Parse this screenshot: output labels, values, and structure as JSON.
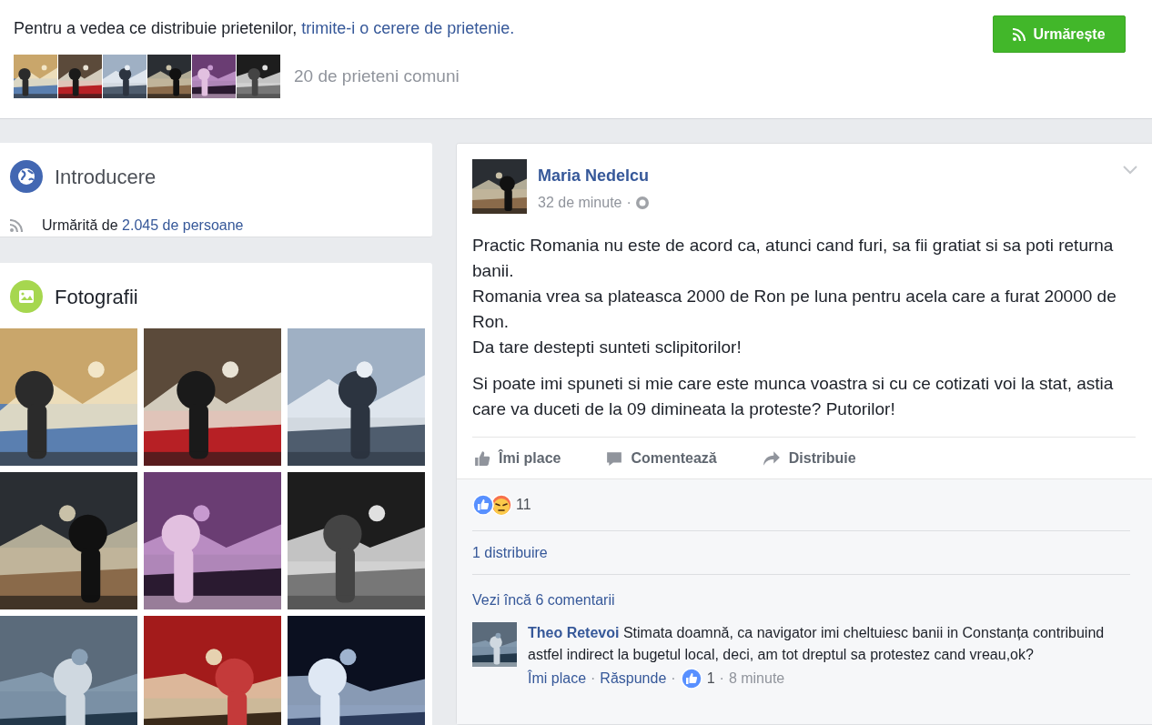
{
  "header": {
    "prompt": "Pentru a vedea ce distribuie prietenilor,",
    "prompt_link": "trimite-i o cerere de prietenie.",
    "mutual_count": "20 de prieteni comuni",
    "follow_button": "Urmărește"
  },
  "intro": {
    "title": "Introducere",
    "followed_by": "Urmărită de",
    "followers_link": "2.045 de persoane"
  },
  "photos": {
    "title": "Fotografii"
  },
  "post": {
    "author": "Maria Nedelcu",
    "time": "32 de minute",
    "separator": "·",
    "paragraphs": [
      "Practic Romania nu este de acord ca, atunci cand furi, sa fii gratiat si sa poti returna banii.\nRomania vrea sa plateasca 2000 de Ron pe luna pentru acela care a furat 20000 de Ron.\nDa tare destepti sunteti sclipitorilor!",
      "Si poate imi spuneti si mie care este munca voastra si cu ce cotizati voi la stat, astia care va duceti de la 09 dimineata la proteste? Putorilor!"
    ],
    "actions": [
      {
        "kind": "like",
        "label": "Îmi place"
      },
      {
        "kind": "comment",
        "label": "Comentează"
      },
      {
        "kind": "share",
        "label": "Distribuie"
      }
    ],
    "reactions": [
      {
        "kind": "like"
      },
      {
        "kind": "angry"
      }
    ],
    "reaction_count": "11",
    "shares": "1 distribuire",
    "more_comments": "Vezi încă 6 comentarii",
    "comments": [
      {
        "author": "Theo Retevoi",
        "text": "Stimata doamnă, ca navigator imi cheltuiesc banii in Constanța contribuind astfel indirect la bugetul local, deci, am tot dreptul sa protestez cand vreau,ok?",
        "like": "Îmi place",
        "reply": "Răspunde",
        "likes": "1",
        "time": "8 minute"
      }
    ]
  }
}
